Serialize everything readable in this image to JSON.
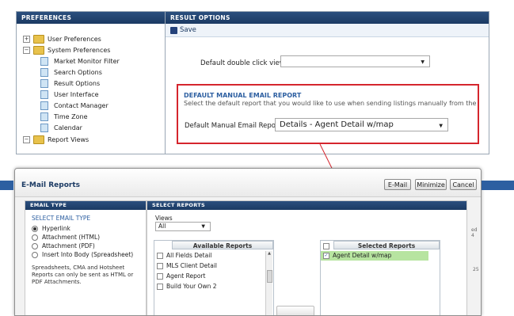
{
  "preferences": {
    "header": "PREFERENCES",
    "tree": [
      {
        "label": "User Preferences",
        "expander": "+",
        "icon": "folder"
      },
      {
        "label": "System Preferences",
        "expander": "−",
        "icon": "folder"
      },
      {
        "label": "Market Monitor Filter",
        "icon": "page"
      },
      {
        "label": "Search Options",
        "icon": "page"
      },
      {
        "label": "Result Options",
        "icon": "page"
      },
      {
        "label": "User Interface",
        "icon": "page"
      },
      {
        "label": "Contact Manager",
        "icon": "page"
      },
      {
        "label": "Time Zone",
        "icon": "page"
      },
      {
        "label": "Calendar",
        "icon": "page"
      },
      {
        "label": "Report Views",
        "expander": "−",
        "icon": "folder"
      }
    ]
  },
  "result_options": {
    "header": "RESULT OPTIONS",
    "save_label": "Save",
    "double_click_label": "Default double click view",
    "double_click_value": "",
    "manual_email": {
      "title": "DEFAULT MANUAL EMAIL REPORT",
      "description": "Select the default report that you would like to use when sending listings manually from the system.",
      "field_label": "Default Manual Email Report",
      "field_value": "Details - Agent Detail w/map"
    }
  },
  "dialog": {
    "title": "E-Mail Reports",
    "buttons": {
      "email": "E-Mail",
      "minimize": "Minimize",
      "cancel": "Cancel"
    },
    "email_type": {
      "header": "EMAIL TYPE",
      "section_label": "SELECT EMAIL TYPE",
      "options": [
        {
          "label": "Hyperlink",
          "selected": true
        },
        {
          "label": "Attachment (HTML)",
          "selected": false
        },
        {
          "label": "Attachment (PDF)",
          "selected": false
        },
        {
          "label": "Insert Into Body (Spreadsheet)",
          "selected": false
        }
      ],
      "note": "Spreadsheets, CMA and Hotsheet Reports can only be sent as HTML or PDF Attachments."
    },
    "select_reports": {
      "header": "SELECT REPORTS",
      "views_label": "Views",
      "views_value": "All",
      "available_header": "Available Reports",
      "available": [
        "All Fields Detail",
        "MLS Client Detail",
        "Agent Report",
        "Build Your Own 2"
      ],
      "selected_header": "Selected Reports",
      "selected": [
        "Agent Detail w/map"
      ]
    },
    "edge_fragments": {
      "right_1": "ed 4",
      "right_2": "25"
    }
  },
  "colors": {
    "header_blue": "#1b3a63",
    "accent_blue": "#2d5fa1",
    "highlight_red": "#d5252d",
    "selected_green": "#b7e4a0"
  }
}
